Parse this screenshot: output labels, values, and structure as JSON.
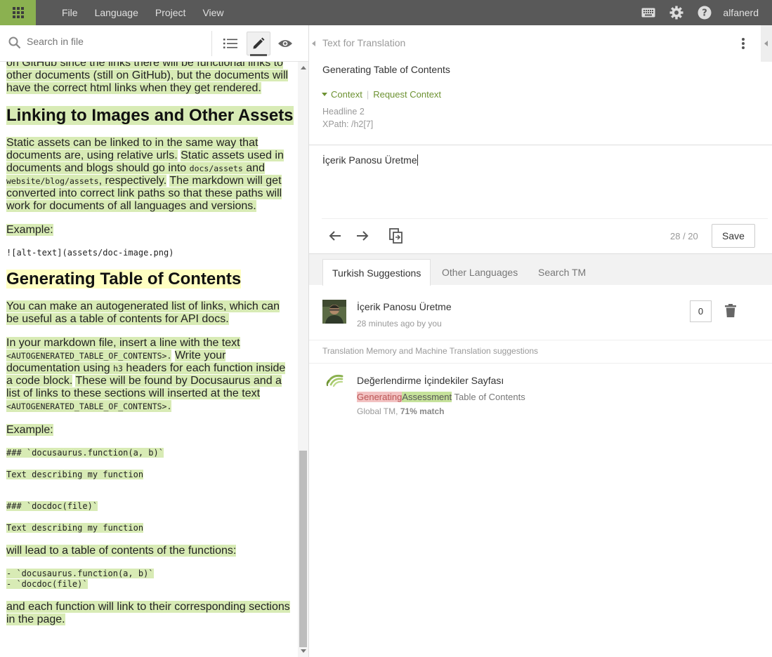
{
  "menu": [
    "File",
    "Language",
    "Project",
    "View"
  ],
  "user": "alfanerd",
  "left_toolbar": {
    "search_placeholder": "Search in file"
  },
  "doc": {
    "p1": "on GitHub since the links there will be functional links to other documents (still on GitHub), but the documents will have the correct html links when they get rendered.",
    "h_linking": "Linking to Images and Other Assets",
    "p2a": "Static assets can be linked to in the same way that documents are, using relative urls.",
    "p2b": "Static assets used in documents and blogs should go into",
    "p2c1": "docs/assets",
    "p2d": "and",
    "p2c2": "website/blog/assets",
    "p2e": ", respectively.",
    "p2f": "The markdown will get converted into correct link paths so that these paths will work for documents of all languages and versions.",
    "example1": "Example:",
    "code1": "![alt-text](assets/doc-image.png)",
    "h_toc": "Generating Table of Contents",
    "p3": "You can make an autogenerated list of links, which can be useful as a table of contents for API docs.",
    "p4a": "In your markdown file, insert a line with the text",
    "p4b": "<AUTOGENERATED_TABLE_OF_CONTENTS>.",
    "p4c": "Write your documentation using",
    "p4d": "h3",
    "p4e": "headers for each function inside a code block.",
    "p4f": "These will be found by Docusaurus and a list of links to these sections will inserted at the text",
    "p4g": "<AUTOGENERATED_TABLE_OF_CONTENTS>.",
    "example2": "Example:",
    "code2": "### `docusaurus.function(a, b)`",
    "code3": "Text describing my function",
    "code4": "### `docdoc(file)`",
    "code5": "Text describing my function",
    "p5": "will lead to a table of contents of the functions:",
    "code6a": "- `docusaurus.function(a, b)`",
    "code6b": "- `docdoc(file)`",
    "p6": "and each function will link to their corresponding sections in the page."
  },
  "editor": {
    "panel_title": "Text for Translation",
    "source_text": "Generating Table of Contents",
    "context_label": "Context",
    "request_context_label": "Request Context",
    "meta_headline": "Headline 2",
    "meta_xpath": "XPath: /h2[7]",
    "translation": "İçerik Panosu Üretme",
    "counter": "28 / 20",
    "save_label": "Save"
  },
  "tabs": [
    "Turkish Suggestions",
    "Other Languages",
    "Search TM"
  ],
  "suggestion": {
    "text": "İçerik Panosu Üretme",
    "meta": "28 minutes ago by you",
    "votes": "0"
  },
  "tm": {
    "header": "Translation Memory and Machine Translation suggestions",
    "text": "Değerlendirme İçindekiler Sayfası",
    "diff_deleted": "Generating",
    "diff_inserted": "Assessment",
    "diff_rest": " Table of Contents",
    "meta_source": "Global TM, ",
    "meta_match": "71% match"
  },
  "colors": {
    "topbar": "#595959",
    "accent": "#8bb150",
    "highlight": "#d8ebb5",
    "highlight_active": "#ffffc2"
  }
}
